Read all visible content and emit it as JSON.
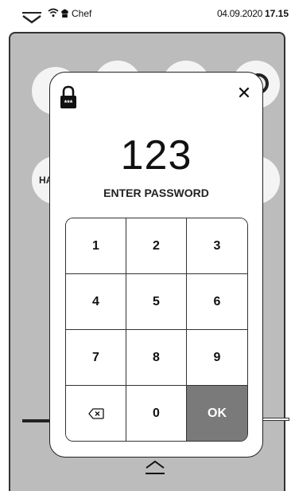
{
  "status_bar": {
    "user_role": "Chef",
    "date": "04.09.2020",
    "time": "17.15",
    "icons": [
      "menu-collapse-icon",
      "wifi-icon",
      "chef-user-icon"
    ]
  },
  "background": {
    "partial_label": "HA"
  },
  "password_dialog": {
    "value": "123",
    "label": "ENTER PASSWORD",
    "close_glyph": "✕",
    "lock_icon_text": "***",
    "keys": [
      "1",
      "2",
      "3",
      "4",
      "5",
      "6",
      "7",
      "8",
      "9",
      "⌫",
      "0",
      "OK"
    ],
    "ok_label": "OK"
  },
  "colors": {
    "overlay_gray": "#bcbcbc",
    "ok_key": "#7a7a7a"
  }
}
